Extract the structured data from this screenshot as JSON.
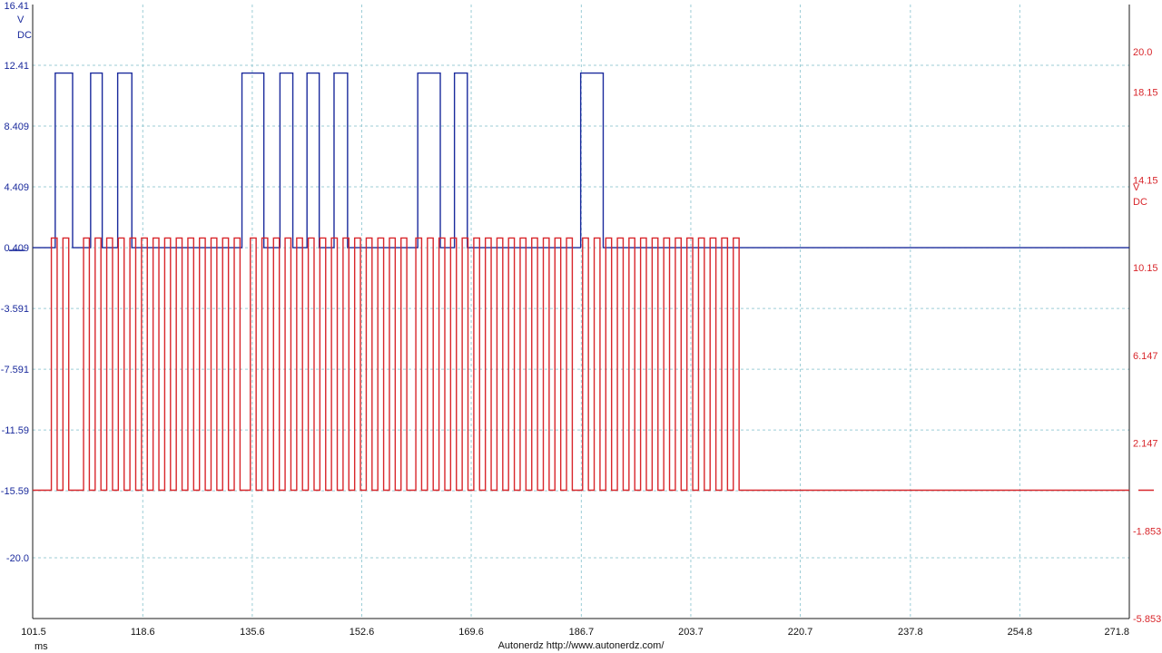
{
  "chart_data": {
    "type": "line",
    "x_unit": "ms",
    "xlim": [
      101.5,
      271.8
    ],
    "x_ticks": [
      "101.5",
      "118.6",
      "135.6",
      "152.6",
      "169.6",
      "186.7",
      "203.7",
      "220.7",
      "237.8",
      "254.8",
      "271.8"
    ],
    "grid": true,
    "credit": "Autonerdz   http://www.autonerdz.com/",
    "axes": [
      {
        "side": "left",
        "unit_lines": [
          "V",
          "DC"
        ],
        "ylim": [
          -24.0,
          16.41
        ],
        "ticks": [
          "16.41",
          "12.41",
          "8.409",
          "4.409",
          "0.409",
          "-3.591",
          "-7.591",
          "-11.59",
          "-15.59",
          "-20.0"
        ],
        "color": "#1a2a9c"
      },
      {
        "side": "right",
        "unit_lines": [
          "V",
          "DC"
        ],
        "ylim": [
          -5.853,
          22.15
        ],
        "ticks": [
          "20.0",
          "18.15",
          "14.15",
          "10.15",
          "6.147",
          "2.147",
          "-1.853",
          "-5.853"
        ],
        "color": "#d8262b"
      }
    ],
    "series": [
      {
        "axis": "left",
        "color": "#1a2a9c",
        "low": 0.409,
        "high": 11.9,
        "pulses_ms": [
          [
            105.0,
            107.7
          ],
          [
            110.5,
            112.3
          ],
          [
            114.7,
            116.9
          ],
          [
            134.0,
            137.4
          ],
          [
            139.9,
            141.9
          ],
          [
            144.1,
            146.0
          ],
          [
            148.3,
            150.4
          ],
          [
            161.3,
            164.8
          ],
          [
            167.0,
            169.0
          ],
          [
            186.6,
            190.1
          ]
        ]
      },
      {
        "axis": "right",
        "color": "#d8262b",
        "low": 0.0,
        "high": 11.5,
        "period_ms": 1.8,
        "high_ms": 0.9,
        "bursts": [
          {
            "start": 104.4,
            "count": 2
          },
          {
            "start": 109.4,
            "count": 14
          },
          {
            "start": 135.3,
            "count": 14
          },
          {
            "start": 161.0,
            "count": 14
          },
          {
            "start": 186.9,
            "count": 14
          }
        ]
      }
    ]
  }
}
